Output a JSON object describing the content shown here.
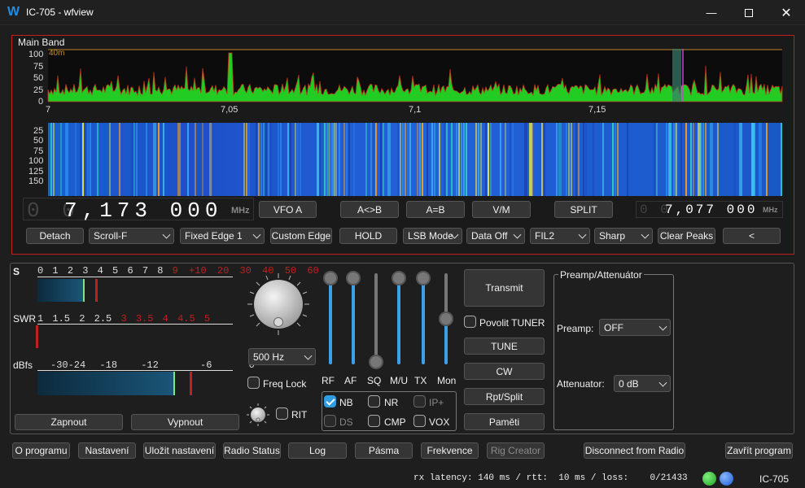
{
  "window": {
    "title": "IC-705 - wfview",
    "app_icon": "W"
  },
  "spectrum": {
    "label": "Main Band",
    "band_label": "40m",
    "y_ticks": [
      "100",
      "75",
      "50",
      "25",
      "0"
    ],
    "x_ticks": [
      "7",
      "7,05",
      "7,1",
      "7,15"
    ],
    "wf_ticks": [
      "25",
      "50",
      "75",
      "100",
      "125",
      "150"
    ]
  },
  "freq": {
    "ghost_main": "0 0",
    "main": "7,173 000",
    "main_unit": "MHz",
    "ghost_sub": "0 0",
    "sub": "7,077 000",
    "sub_unit": "MHz"
  },
  "vfo_buttons": {
    "vfo_a": "VFO A",
    "a_swap_b": "A<>B",
    "a_eq_b": "A=B",
    "vm": "V/M",
    "split": "SPLIT"
  },
  "toolbar": {
    "detach": "Detach",
    "scroll": "Scroll-F",
    "edge": "Fixed Edge 1",
    "custom_edge": "Custom Edge",
    "hold": "HOLD",
    "mode": "LSB Mode",
    "data": "Data Off",
    "filter": "FIL2",
    "shape": "Sharp",
    "clear_peaks": "Clear Peaks",
    "back": "<"
  },
  "meters": {
    "s_label": "S",
    "s_ticks": [
      "0",
      "1",
      "2",
      "3",
      "4",
      "5",
      "6",
      "7",
      "8",
      "9"
    ],
    "s_red_ticks": [
      "+10",
      "20",
      "30",
      "40",
      "50",
      "60"
    ],
    "s_level": 0.58,
    "swr_label": "SWR",
    "swr_ticks": [
      "1",
      "1.5",
      "2",
      "2.5"
    ],
    "swr_red_ticks": [
      "3",
      "3.5",
      "4",
      "4.5",
      "5"
    ],
    "dbfs_label": "dBfs",
    "dbfs_ticks": [
      "-30",
      "-24",
      "-18",
      "-12",
      "-6",
      "0"
    ],
    "dbfs_level": 0.71,
    "power_on": "Zapnout",
    "power_off": "Vypnout"
  },
  "tuning": {
    "step": "500 Hz",
    "freq_lock": "Freq  Lock",
    "rit": "RIT"
  },
  "sliders": {
    "labels": [
      "RF",
      "AF",
      "SQ",
      "M/U",
      "TX",
      "Mon"
    ],
    "levels": [
      1.0,
      1.0,
      0.0,
      1.0,
      1.0,
      0.5
    ]
  },
  "functions": {
    "nb": "NB",
    "nr": "NR",
    "ipplus": "IP+",
    "ds": "DS",
    "cmp": "CMP",
    "vox": "VOX"
  },
  "tx": {
    "transmit": "Transmit",
    "enable_tuner": "Povolit TUNER",
    "tune": "TUNE",
    "cw": "CW",
    "rpt": "Rpt/Split",
    "memories": "Paměti"
  },
  "preamp": {
    "group": "Preamp/Attenuátor",
    "preamp_label": "Preamp:",
    "preamp_value": "OFF",
    "att_label": "Attenuator:",
    "att_value": "0 dB"
  },
  "bottom": {
    "about": "O programu",
    "settings": "Nastavení",
    "save": "Uložit nastavení",
    "radio_status": "Radio Status",
    "log": "Log",
    "bands": "Pásma",
    "frequency": "Frekvence",
    "rig_creator": "Rig Creator",
    "disconnect": "Disconnect from Radio",
    "close": "Zavřít program"
  },
  "status": {
    "latency": "rx latency: 140 ms / rtt:  10 ms / loss:    0/21433",
    "radio": "IC-705"
  },
  "colors": {
    "accent": "#2f9de0",
    "border_red": "#c02020",
    "spectrum_green": "#22cc22",
    "led_green": "#22c022",
    "led_blue": "#2a7ae0"
  }
}
